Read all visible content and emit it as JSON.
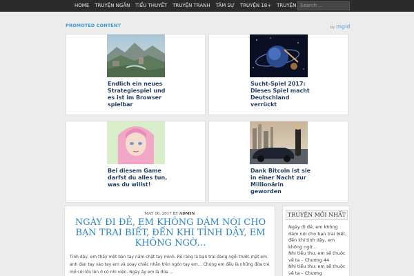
{
  "nav": {
    "items": [
      {
        "label": "HOME"
      },
      {
        "label": "TRUYỆN NGẮN"
      },
      {
        "label": "TIỂU THUYẾT"
      },
      {
        "label": "TRUYỆN TRANH"
      },
      {
        "label": "TÂM SỰ"
      },
      {
        "label": "TRUYỆN 18+"
      },
      {
        "label": "TRUYỆN CƯỜI"
      }
    ],
    "search_placeholder": "Search ..."
  },
  "promoted": {
    "label": "PROMOTED CONTENT",
    "provider": "mgid",
    "provider_prefix": "by",
    "cards": [
      {
        "title": "Endlich ein neues Strategiespiel und es ist im Browser spielbar",
        "image": "castle-landscape-image"
      },
      {
        "title": "Sucht-Spiel 2017: Dieses Spiel macht Deutschland verrückt",
        "image": "space-planet-image"
      },
      {
        "title": "Bei diesem Game darfst du alles tun, was du willst!",
        "image": "anime-girl-image"
      },
      {
        "title": "Dank Bitcoin ist sie in einer Nacht zur Millionärin geworden",
        "image": "woman-sports-car-image"
      }
    ]
  },
  "article": {
    "date": "MAY 16, 2017",
    "by": "BY",
    "author": "ADMIN",
    "title": "NGÀY ĐI ĐẺ, EM KHÔNG DÁM NÓI CHO BẠN TRAI BIẾT, ĐẾN KHI TỈNH DẬY, EM KHÔNG NGỜ…",
    "excerpt": "Tỉnh dậy, em thấy một bàn tay nắm chặt tay mình. Rõ ràng là bạn trai đang ngồi trước mặt em. anh đan tay vào tay em và xoay chiếc nhẫn trên ngón tay em… Chúng em đều là những đứa trẻ mồ côi lớn lên ở cô nhi viện. Ngày ấy em là đứa …"
  },
  "sidebar": {
    "title": "TRUYỆN MỚI NHẤT",
    "links": [
      "Ngày đi đẻ, em không dám nói cho bạn trai biết, đến khi tỉnh dậy, em không ngờ…",
      "Nhị tiểu thư, em sẽ thuộc về ta – Chương 44",
      "Nhị tiểu thư, em sẽ thuộc về ta – Chương"
    ]
  }
}
